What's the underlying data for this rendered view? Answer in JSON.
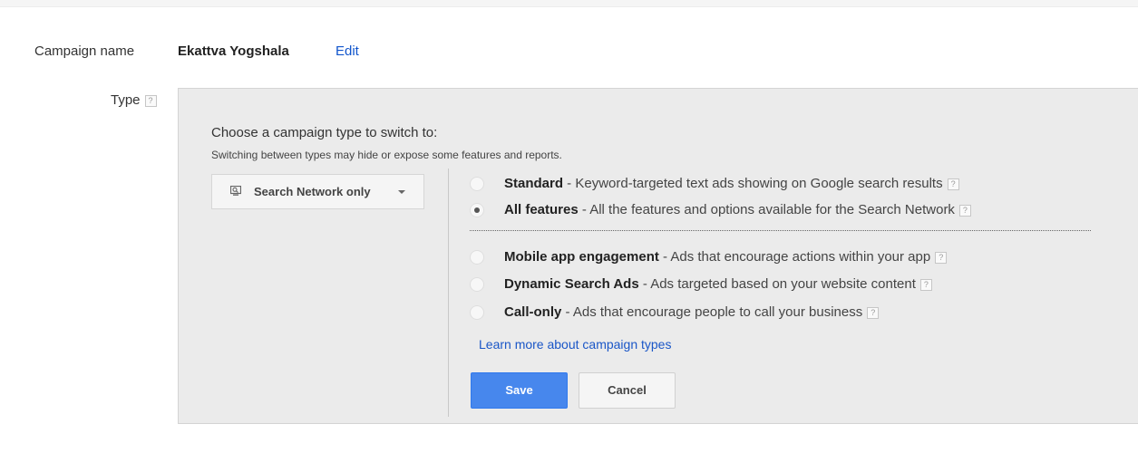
{
  "campaign": {
    "name_label": "Campaign name",
    "name_value": "Ekattva Yogshala",
    "edit_label": "Edit"
  },
  "type_field": {
    "label": "Type",
    "help": "?"
  },
  "panel": {
    "heading": "Choose a campaign type to switch to:",
    "note": "Switching between types may hide or expose some features and reports.",
    "network_dropdown": {
      "icon": "search-network-icon",
      "label": "Search Network only"
    },
    "options": [
      {
        "name": "Standard",
        "description": " - Keyword-targeted text ads showing on Google search results",
        "selected": false,
        "help": "?"
      },
      {
        "name": "All features",
        "description": " - All the features and options available for the Search Network",
        "selected": true,
        "help": "?"
      },
      {
        "name": "Mobile app engagement",
        "description": " - Ads that encourage actions within your app",
        "selected": false,
        "help": "?"
      },
      {
        "name": "Dynamic Search Ads",
        "description": " - Ads targeted based on your website content",
        "selected": false,
        "help": "?"
      },
      {
        "name": "Call-only",
        "description": " - Ads that encourage people to call your business",
        "selected": false,
        "help": "?"
      }
    ],
    "learn_more": "Learn more about campaign types",
    "save_label": "Save",
    "cancel_label": "Cancel"
  },
  "colors": {
    "link": "#1155cc",
    "primary_button": "#4787ed",
    "panel_background": "#ebebeb"
  }
}
